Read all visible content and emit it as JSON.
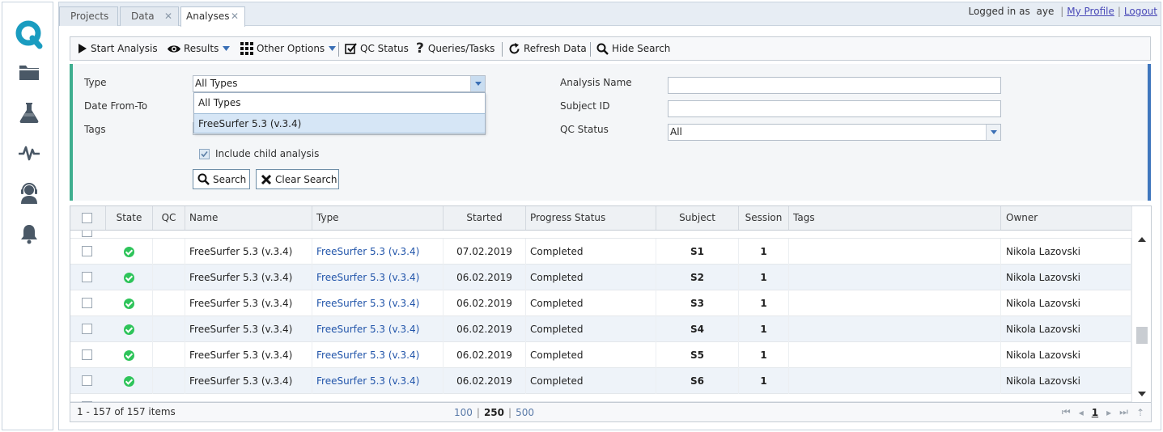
{
  "colors": {
    "brand": "#1a9cc0",
    "accent_left": "#3fae8f",
    "accent_right": "#3f76bd",
    "link": "#2255aa",
    "ok": "#2ec45a"
  },
  "sidebar": {
    "logo_icon": "q-logo-icon",
    "items": [
      {
        "icon": "folder-icon"
      },
      {
        "icon": "flask-icon"
      },
      {
        "icon": "pulse-icon"
      },
      {
        "icon": "support-agent-icon"
      },
      {
        "icon": "bell-icon"
      }
    ]
  },
  "tabs": [
    {
      "label": "Projects",
      "closable": false
    },
    {
      "label": "Data",
      "closable": true
    },
    {
      "label": "Analyses",
      "closable": true,
      "active": true
    }
  ],
  "user": {
    "logged_in_label": "Logged in as",
    "username": "aye",
    "profile_link": "My Profile",
    "logout_link": "Logout"
  },
  "toolbar": {
    "start_analysis": "Start Analysis",
    "results": "Results",
    "other_options": "Other Options",
    "qc_status": "QC Status",
    "queries_tasks": "Queries/Tasks",
    "refresh_data": "Refresh Data",
    "hide_search": "Hide Search"
  },
  "search": {
    "type_label": "Type",
    "type_value": "All Types",
    "type_options": [
      "All Types",
      "FreeSurfer 5.3 (v.3.4)"
    ],
    "type_selected_index": 1,
    "date_label": "Date From-To",
    "tags_label": "Tags",
    "include_child": "Include child analysis",
    "include_child_checked": true,
    "analysis_name_label": "Analysis Name",
    "analysis_name_value": "",
    "subject_id_label": "Subject ID",
    "subject_id_value": "",
    "qc_status_label": "QC Status",
    "qc_status_value": "All",
    "search_button": "Search",
    "clear_button": "Clear Search"
  },
  "grid": {
    "columns": [
      "State",
      "QC",
      "Name",
      "Type",
      "Started",
      "Progress Status",
      "Subject",
      "Session",
      "Tags",
      "Owner"
    ],
    "rows": [
      {
        "state": "ok",
        "qc": "",
        "name": "FreeSurfer 5.3 (v.3.4)",
        "type": "FreeSurfer 5.3 (v.3.4)",
        "started": "07.02.2019",
        "progress": "Completed",
        "subject": "S1",
        "session": "1",
        "tags": "",
        "owner": "Nikola Lazovski"
      },
      {
        "state": "ok",
        "qc": "",
        "name": "FreeSurfer 5.3 (v.3.4)",
        "type": "FreeSurfer 5.3 (v.3.4)",
        "started": "06.02.2019",
        "progress": "Completed",
        "subject": "S2",
        "session": "1",
        "tags": "",
        "owner": "Nikola Lazovski"
      },
      {
        "state": "ok",
        "qc": "",
        "name": "FreeSurfer 5.3 (v.3.4)",
        "type": "FreeSurfer 5.3 (v.3.4)",
        "started": "06.02.2019",
        "progress": "Completed",
        "subject": "S3",
        "session": "1",
        "tags": "",
        "owner": "Nikola Lazovski"
      },
      {
        "state": "ok",
        "qc": "",
        "name": "FreeSurfer 5.3 (v.3.4)",
        "type": "FreeSurfer 5.3 (v.3.4)",
        "started": "06.02.2019",
        "progress": "Completed",
        "subject": "S4",
        "session": "1",
        "tags": "",
        "owner": "Nikola Lazovski"
      },
      {
        "state": "ok",
        "qc": "",
        "name": "FreeSurfer 5.3 (v.3.4)",
        "type": "FreeSurfer 5.3 (v.3.4)",
        "started": "06.02.2019",
        "progress": "Completed",
        "subject": "S5",
        "session": "1",
        "tags": "",
        "owner": "Nikola Lazovski"
      },
      {
        "state": "ok",
        "qc": "",
        "name": "FreeSurfer 5.3 (v.3.4)",
        "type": "FreeSurfer 5.3 (v.3.4)",
        "started": "06.02.2019",
        "progress": "Completed",
        "subject": "S6",
        "session": "1",
        "tags": "",
        "owner": "Nikola Lazovski"
      }
    ],
    "footer": {
      "items_info": "1 - 157 of 157 items",
      "page_sizes": [
        "100",
        "250",
        "500"
      ],
      "current_page_size": "250",
      "current_page": "1"
    }
  }
}
